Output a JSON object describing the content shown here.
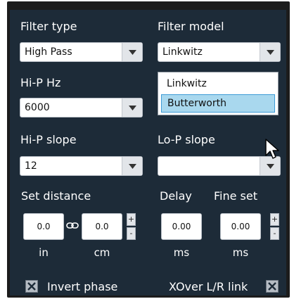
{
  "filter_type": {
    "label": "Filter type",
    "value": "High Pass"
  },
  "filter_model": {
    "label": "Filter model",
    "value": "Linkwitz",
    "options": [
      "Linkwitz",
      "Butterworth"
    ],
    "highlighted": "Butterworth"
  },
  "hip_hz": {
    "label": "Hi-P Hz",
    "value": "6000"
  },
  "hip_slope": {
    "label": "Hi-P slope",
    "value": "12"
  },
  "lop_slope": {
    "label": "Lo-P slope",
    "value": ""
  },
  "set_distance": {
    "label": "Set distance",
    "in_value": "0.0",
    "cm_value": "0.0",
    "in_unit": "in",
    "cm_unit": "cm"
  },
  "delay": {
    "label": "Delay",
    "value": "0.00",
    "unit": "ms"
  },
  "fine_set": {
    "label": "Fine set",
    "value": "0.00",
    "unit": "ms"
  },
  "spin": {
    "plus": "+",
    "minus": "-"
  },
  "invert_phase": {
    "label": "Invert phase",
    "checked": true
  },
  "xover_link": {
    "label": "XOver L/R link",
    "checked": true
  },
  "colors": {
    "panel": "#1d2b38",
    "highlight": "#a9d8ee",
    "highlight_border": "#3d9bd6"
  }
}
